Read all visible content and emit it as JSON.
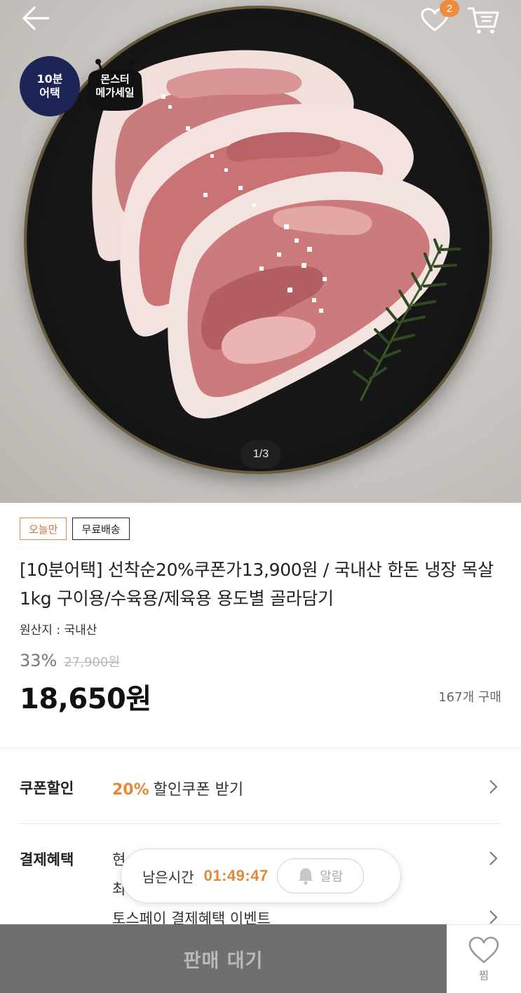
{
  "header": {
    "back_icon": "arrow-left-icon",
    "wish_icon": "heart-icon",
    "wish_count": "2",
    "cart_icon": "cart-icon"
  },
  "hero": {
    "badge_10min_line1": "10분",
    "badge_10min_line2": "어택",
    "badge_monster_line1": "몬스터",
    "badge_monster_line2": "메가세일",
    "pager": "1/3"
  },
  "product": {
    "tags": [
      "오늘만",
      "무료배송"
    ],
    "title": "[10분어택] 선착순20%쿠폰가13,900원 / 국내산 한돈 냉장 목살 1kg 구이용/수육용/제육용 용도별 골라담기",
    "origin": "원산지 : 국내산",
    "discount": "33%",
    "original_price": "27,900원",
    "price": "18,650원",
    "buy_count": "167개 구매"
  },
  "coupon": {
    "label": "쿠폰할인",
    "percent": "20%",
    "text": "할인쿠폰 받기"
  },
  "payment": {
    "label": "결제혜택",
    "line1": "현",
    "line2": "최",
    "line3": "토스페이 결제혜택 이벤트"
  },
  "timer": {
    "label": "남은시간",
    "time": "01:49:47",
    "alarm_label": "알람",
    "alarm_icon": "bell-icon"
  },
  "bottom": {
    "sale_button": "판매 대기",
    "jjim_label": "찜",
    "jjim_icon": "heart-outline-icon"
  },
  "colors": {
    "accent": "#e08a3a",
    "badge_navy": "#1d2456",
    "sale_button_bg": "#6f6f6f"
  }
}
